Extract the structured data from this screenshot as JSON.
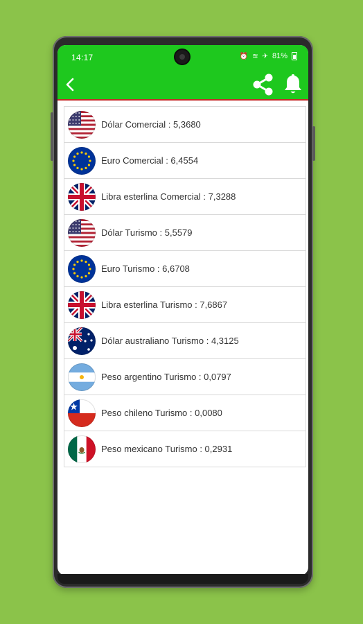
{
  "status": {
    "time": "14:17",
    "battery_text": "81%"
  },
  "appbar": {
    "accent": "#1ec81e",
    "divider": "#c62828"
  },
  "rates": [
    {
      "label": "Dólar Comercial : 5,3680",
      "flag": "usa-flag-icon"
    },
    {
      "label": "Euro Comercial : 6,4554",
      "flag": "eu-flag-icon"
    },
    {
      "label": "Libra esterlina Comercial : 7,3288",
      "flag": "uk-flag-icon"
    },
    {
      "label": "Dólar Turismo : 5,5579",
      "flag": "usa-flag-icon"
    },
    {
      "label": "Euro Turismo : 6,6708",
      "flag": "eu-flag-icon"
    },
    {
      "label": "Libra esterlina Turismo : 7,6867",
      "flag": "uk-flag-icon"
    },
    {
      "label": "Dólar australiano Turismo : 4,3125",
      "flag": "australia-flag-icon"
    },
    {
      "label": "Peso argentino Turismo : 0,0797",
      "flag": "argentina-flag-icon"
    },
    {
      "label": "Peso chileno Turismo : 0,0080",
      "flag": "chile-flag-icon"
    },
    {
      "label": "Peso mexicano Turismo : 0,2931",
      "flag": "mexico-flag-icon"
    }
  ]
}
